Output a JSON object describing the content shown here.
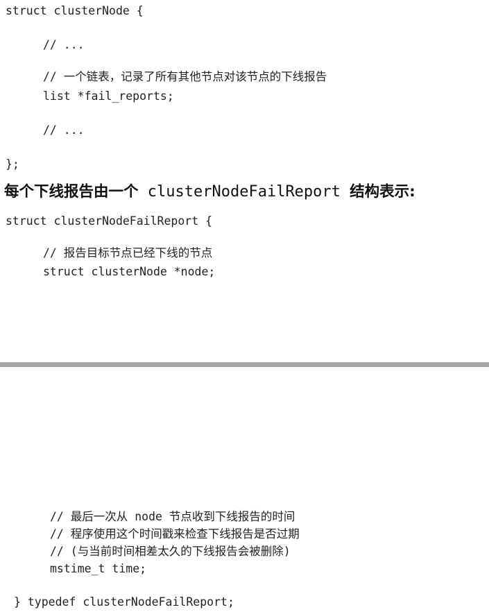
{
  "top_section": {
    "lines": [
      "struct clusterNode {",
      "// ...",
      "// 一个链表，记录了所有其他节点对该节点的下线报告",
      "list *fail_reports;",
      "// ...",
      "};"
    ]
  },
  "heading": {
    "prefix": "每个下线报告由一个",
    "code": " clusterNodeFailReport ",
    "suffix": "结构表示:"
  },
  "middle_section": {
    "lines": [
      "struct clusterNodeFailReport {",
      "// 报告目标节点已经下线的节点",
      "struct clusterNode *node;"
    ]
  },
  "bottom_section": {
    "lines": [
      "// 最后一次从 node 节点收到下线报告的时间",
      "// 程序使用这个时间戳来检查下线报告是否过期",
      "// (与当前时间相差太久的下线报告会被删除)",
      "mstime_t time;",
      "} typedef clusterNodeFailReport;"
    ]
  }
}
